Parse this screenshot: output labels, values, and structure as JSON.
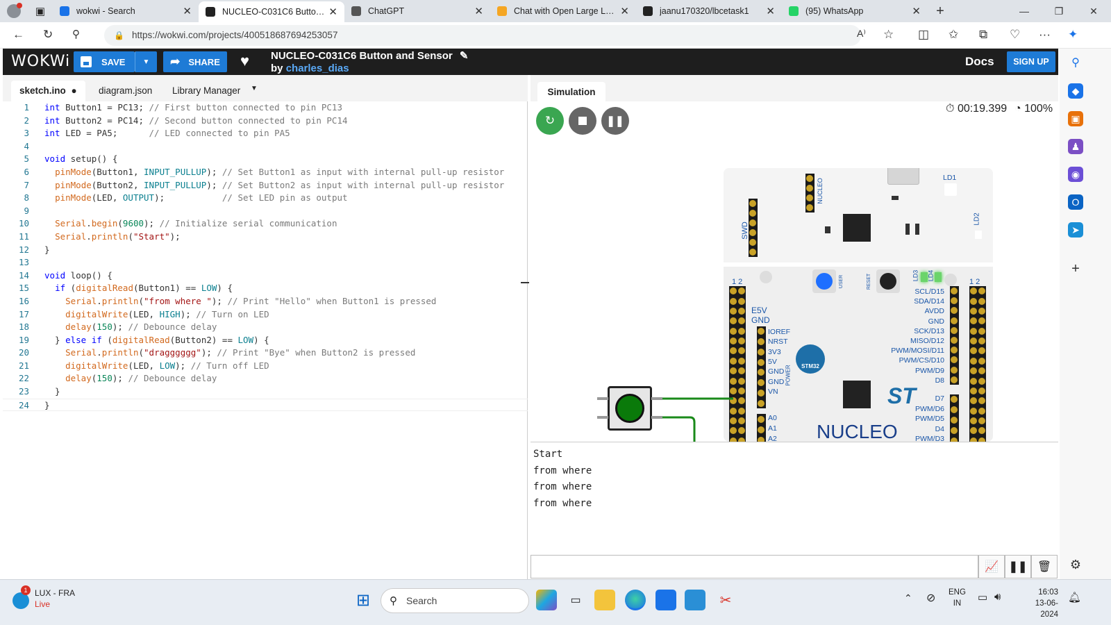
{
  "browser": {
    "tabs": [
      {
        "title": "wokwi - Search",
        "icon": "search-icon",
        "color": "#1a73e8"
      },
      {
        "title": "NUCLEO-C031C6 Button and Sensor",
        "icon": "wokwi-icon",
        "color": "#222222",
        "active": true
      },
      {
        "title": "ChatGPT",
        "icon": "chatgpt-icon",
        "color": "#555555"
      },
      {
        "title": "Chat with Open Large Language Models",
        "icon": "lmsys-icon",
        "color": "#f5a623"
      },
      {
        "title": "jaanu170320/lbcetask1",
        "icon": "github-icon",
        "color": "#222222"
      },
      {
        "title": "(95) WhatsApp",
        "icon": "whatsapp-icon",
        "color": "#25d366"
      }
    ],
    "url": "https://wokwi.com/projects/400518687694253057"
  },
  "wokwi": {
    "logo": "WOKWi",
    "save_label": "SAVE",
    "share_label": "SHARE",
    "project_title": "NUCLEO-C031C6 Button and Sensor",
    "by_label": "by",
    "author": "charles_dias",
    "docs_label": "Docs",
    "signup_label": "SIGN UP"
  },
  "editor": {
    "tabs": [
      "sketch.ino",
      "diagram.json",
      "Library Manager"
    ],
    "active_tab": "sketch.ino"
  },
  "code_lines": [
    "int Button1 = PC13; // First button connected to pin PC13",
    "int Button2 = PC14; // Second button connected to pin PC14",
    "int LED = PA5;      // LED connected to pin PA5",
    "",
    "void setup() {",
    "  pinMode(Button1, INPUT_PULLUP); // Set Button1 as input with internal pull-up resistor",
    "  pinMode(Button2, INPUT_PULLUP); // Set Button2 as input with internal pull-up resistor",
    "  pinMode(LED, OUTPUT);           // Set LED pin as output",
    "",
    "  Serial.begin(9600); // Initialize serial communication",
    "  Serial.println(\"Start\");",
    "}",
    "",
    "void loop() {",
    "  if (digitalRead(Button1) == LOW) {",
    "    Serial.println(\"from where \"); // Print \"Hello\" when Button1 is pressed",
    "    digitalWrite(LED, HIGH); // Turn on LED",
    "    delay(150); // Debounce delay",
    "  } else if (digitalRead(Button2) == LOW) {",
    "    Serial.println(\"dragggggg\"); // Print \"Bye\" when Button2 is pressed",
    "    digitalWrite(LED, LOW); // Turn off LED",
    "    delay(150); // Debounce delay",
    "  }",
    "}"
  ],
  "simulation": {
    "tab_label": "Simulation",
    "timer": "00:19.399",
    "speed": "100%",
    "board": {
      "brand": "NUCLEO",
      "chip_label": "STM32",
      "user_label": "USER",
      "reset_label": "RESET",
      "nucleo_small": "NUCLEO",
      "swd_label": "SWD",
      "ld1": "LD1",
      "ld2": "LD2",
      "ld3": "LD3",
      "ld4": "LD4",
      "e5v": "E5V",
      "gnd": "GND",
      "pin12": "1 2",
      "power_label": "POWER",
      "left_pins": [
        "IOREF",
        "NRST",
        "3V3",
        "5V",
        "GND",
        "GND",
        "VN",
        "A0",
        "A1",
        "A2"
      ],
      "right_pins": [
        "SCL/D15",
        "SDA/D14",
        "AVDD",
        "GND",
        "SCK/D13",
        "MISO/D12",
        "PWM/MOSI/D11",
        "PWM/CS/D10",
        "PWM/D9",
        "D8",
        "D7",
        "PWM/D6",
        "PWM/D5",
        "D4",
        "PWM/D3"
      ]
    }
  },
  "serial": {
    "lines": [
      "Start",
      "from where",
      "from where",
      "from where"
    ]
  },
  "taskbar": {
    "weather_title": "LUX - FRA",
    "weather_sub": "Live",
    "weather_badge": "1",
    "search_placeholder": "Search",
    "lang": "ENG",
    "lang_sub": "IN",
    "time": "16:03",
    "date": "13-06-2024"
  }
}
